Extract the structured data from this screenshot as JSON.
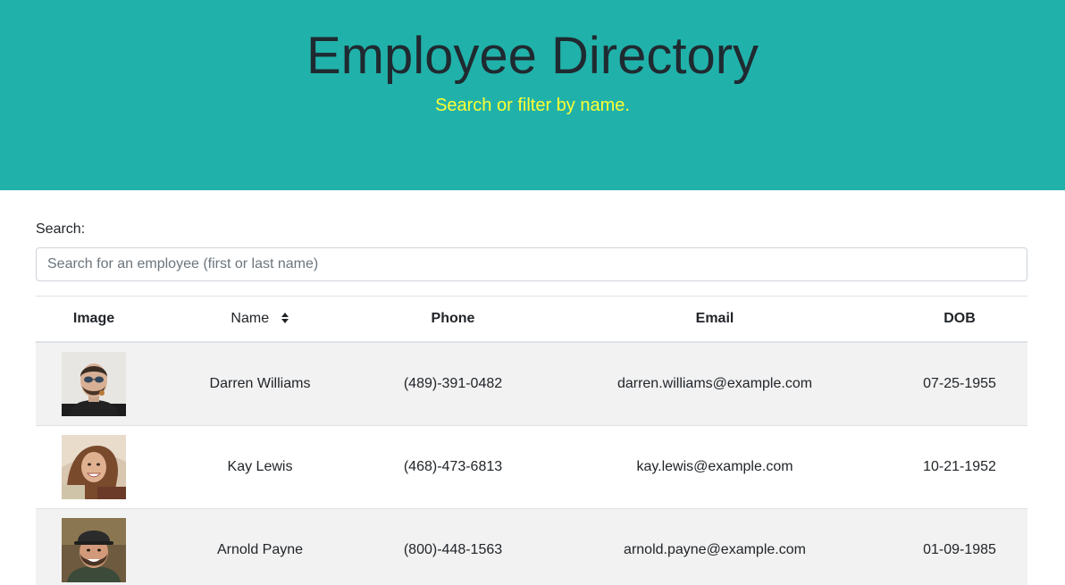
{
  "header": {
    "title": "Employee Directory",
    "subtitle": "Search or filter by name."
  },
  "search": {
    "label": "Search:",
    "placeholder": "Search for an employee (first or last name)",
    "value": ""
  },
  "table": {
    "columns": [
      "Image",
      "Name",
      "Phone",
      "Email",
      "DOB"
    ],
    "sort_icon": "sort-icon",
    "rows": [
      {
        "avatar": "avatar-darren-williams",
        "name": "Darren Williams",
        "phone": "(489)-391-0482",
        "email": "darren.williams@example.com",
        "dob": "07-25-1955"
      },
      {
        "avatar": "avatar-kay-lewis",
        "name": "Kay Lewis",
        "phone": "(468)-473-6813",
        "email": "kay.lewis@example.com",
        "dob": "10-21-1952"
      },
      {
        "avatar": "avatar-arnold-payne",
        "name": "Arnold Payne",
        "phone": "(800)-448-1563",
        "email": "arnold.payne@example.com",
        "dob": "01-09-1985"
      }
    ]
  },
  "colors": {
    "hero_background": "#20b2aa",
    "title_color": "#1f2a30",
    "subtitle_color": "#ffff33",
    "striped_row": "#f2f2f2"
  }
}
